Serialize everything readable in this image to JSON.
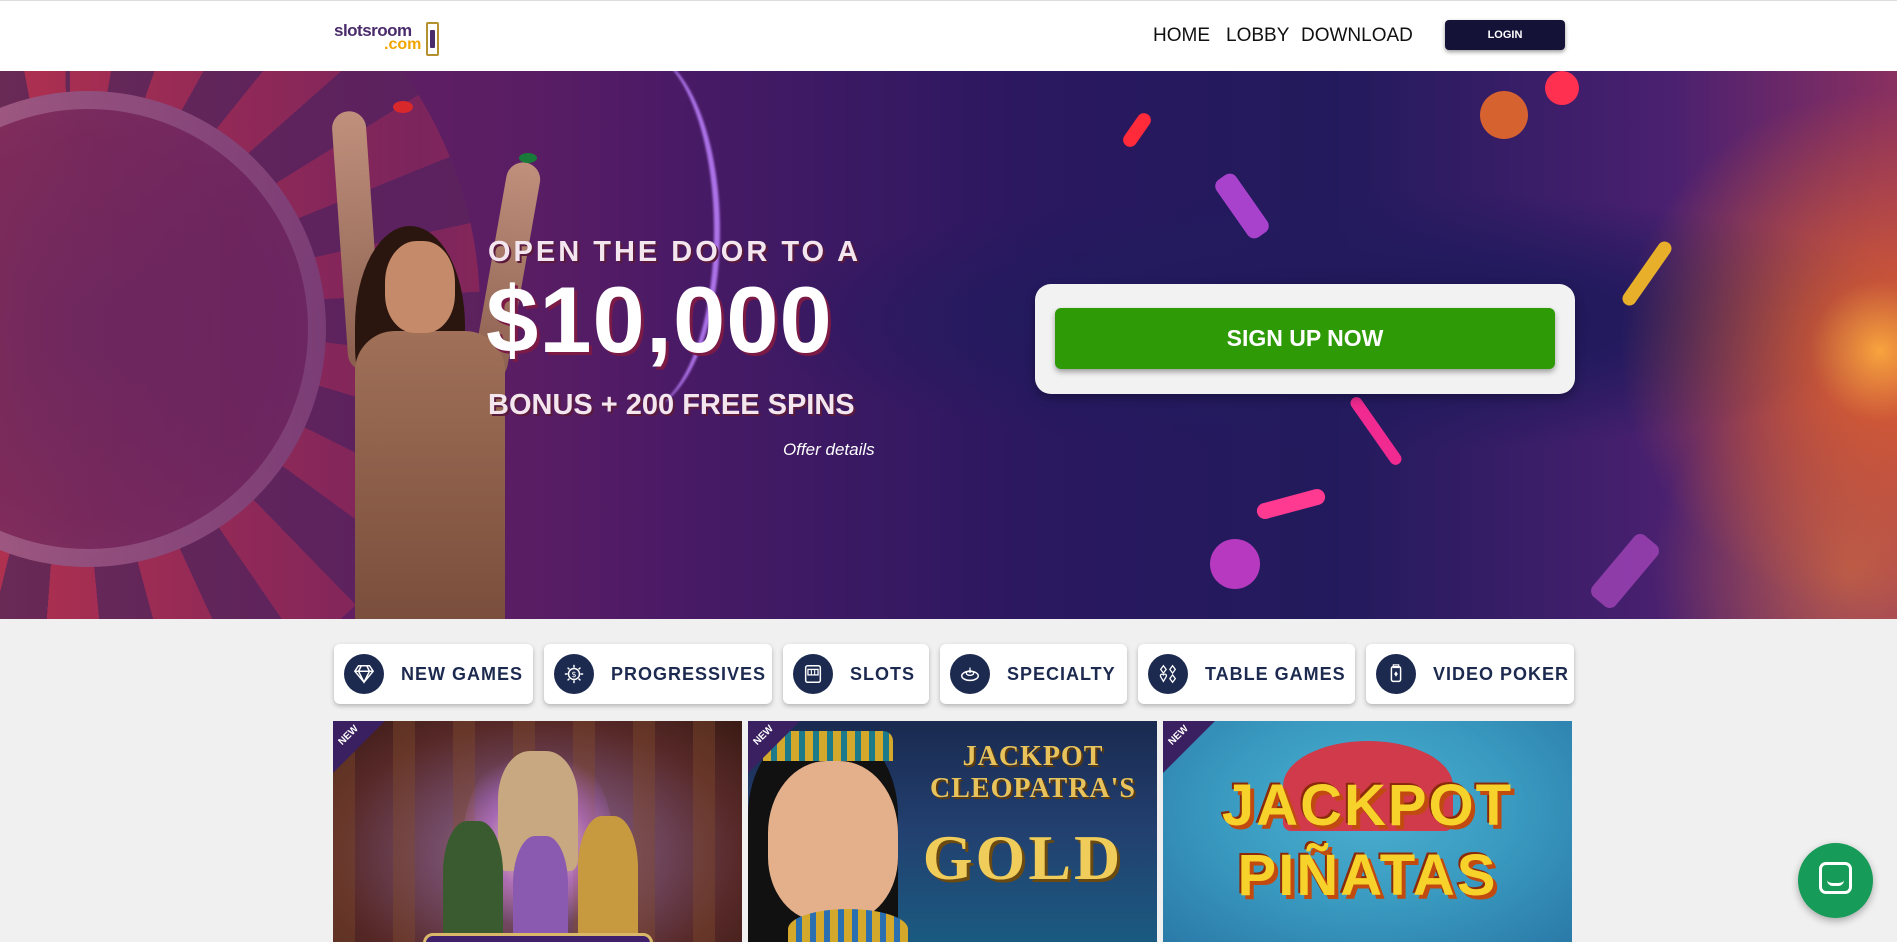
{
  "header": {
    "logo": {
      "line1": "slotsroom",
      "line2": ".com"
    },
    "nav": [
      {
        "label": "HOME"
      },
      {
        "label": "LOBBY"
      },
      {
        "label": "DOWNLOAD"
      }
    ],
    "login_label": "LOGIN"
  },
  "hero": {
    "line1": "OPEN THE DOOR TO A",
    "amount": "$10,000",
    "line3": "BONUS + 200 FREE SPINS",
    "offer_link": "Offer details",
    "signup_label": "SIGN UP NOW"
  },
  "categories": [
    {
      "label": "NEW GAMES",
      "icon": "diamond-icon"
    },
    {
      "label": "PROGRESSIVES",
      "icon": "progressive-icon"
    },
    {
      "label": "SLOTS",
      "icon": "slot-machine-icon"
    },
    {
      "label": "SPECIALTY",
      "icon": "specialty-icon"
    },
    {
      "label": "TABLE GAMES",
      "icon": "card-suits-icon"
    },
    {
      "label": "VIDEO POKER",
      "icon": "video-poker-icon"
    }
  ],
  "games": [
    {
      "badge": "NEW"
    },
    {
      "badge": "NEW",
      "title_line1": "JACKPOT",
      "title_line2": "CLEOPATRA'S",
      "title_line3": "GOLD"
    },
    {
      "badge": "NEW",
      "title_line1": "JACKPOT",
      "title_line2": "PIÑATAS"
    }
  ],
  "colors": {
    "navy": "#151238",
    "signup_green": "#2e9a06",
    "category_navy": "#1c2a50",
    "chat_green": "#179b58"
  }
}
